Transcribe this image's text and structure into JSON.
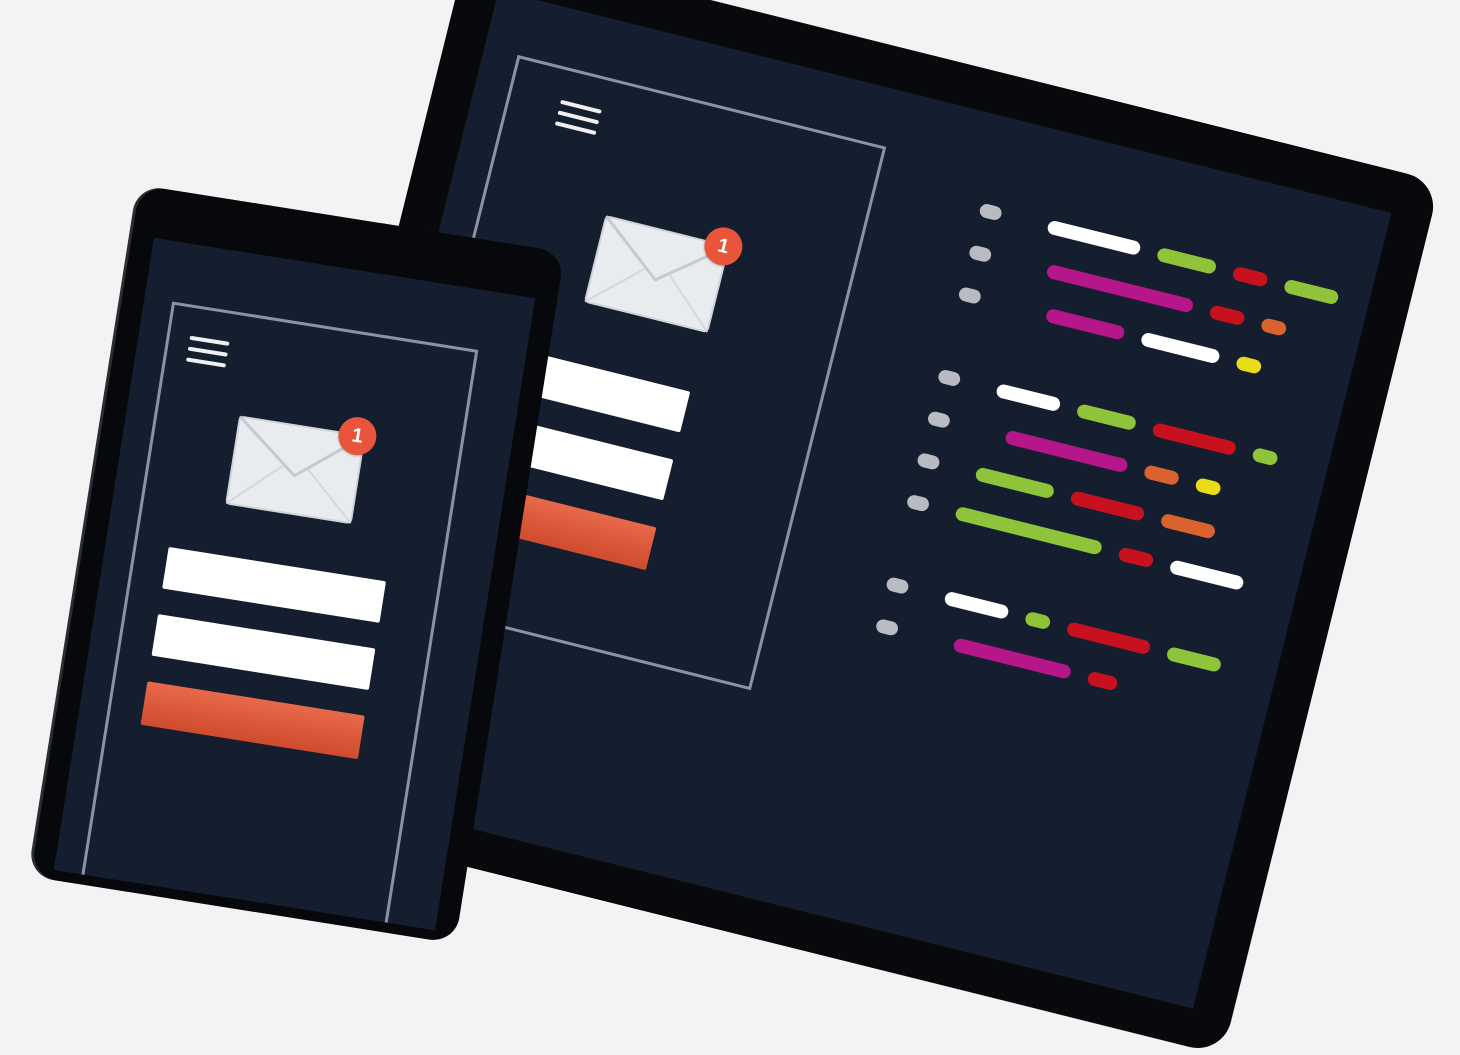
{
  "back_device": {
    "menu_icon": "hamburger-icon",
    "mail_icon": "envelope-icon",
    "notification_count": "1",
    "fields": 2,
    "submit_color": "#e05a3c"
  },
  "front_device": {
    "menu_icon": "hamburger-icon",
    "mail_icon": "envelope-icon",
    "notification_count": "1",
    "fields": 2,
    "submit_color": "#e05a3c"
  },
  "palette": {
    "background": "#f3f3f3",
    "bezel": "#08090c",
    "screen": "#141e2e",
    "frame_line": "#8b93a1",
    "badge": "#e9553b",
    "white": "#ffffff",
    "green": "#8fc43a",
    "magenta": "#b5178a",
    "red": "#c8111f",
    "orange": "#d9622f",
    "yellow": "#e8dc1a",
    "gray": "#b8bbc1"
  },
  "code_lines": [
    {
      "tokens": [
        [
          "white",
          95
        ],
        [
          "green",
          60
        ],
        [
          "red",
          35
        ],
        [
          "green",
          55
        ]
      ]
    },
    {
      "tokens": [
        [
          "magenta",
          150
        ],
        [
          "red",
          35
        ],
        [
          "orange",
          25
        ]
      ]
    },
    {
      "tokens": [
        [
          "magenta",
          80
        ],
        [
          "white",
          80
        ],
        [
          "yellow",
          25
        ]
      ]
    },
    {
      "tokens": [
        [
          "white",
          65
        ],
        [
          "green",
          60
        ],
        [
          "red",
          85
        ],
        [
          "green",
          25
        ]
      ]
    },
    {
      "tokens": [
        [
          "magenta",
          125
        ],
        [
          "orange",
          35
        ],
        [
          "yellow",
          25
        ]
      ]
    },
    {
      "tokens": [
        [
          "green",
          80
        ],
        [
          "red",
          75
        ],
        [
          "orange",
          55
        ]
      ]
    },
    {
      "tokens": [
        [
          "green",
          150
        ],
        [
          "red",
          35
        ],
        [
          "white",
          75
        ]
      ]
    },
    {
      "tokens": [
        [
          "white",
          65
        ],
        [
          "green",
          25
        ],
        [
          "red",
          85
        ],
        [
          "green",
          55
        ]
      ]
    },
    {
      "tokens": [
        [
          "magenta",
          120
        ],
        [
          "red",
          30
        ]
      ]
    }
  ]
}
